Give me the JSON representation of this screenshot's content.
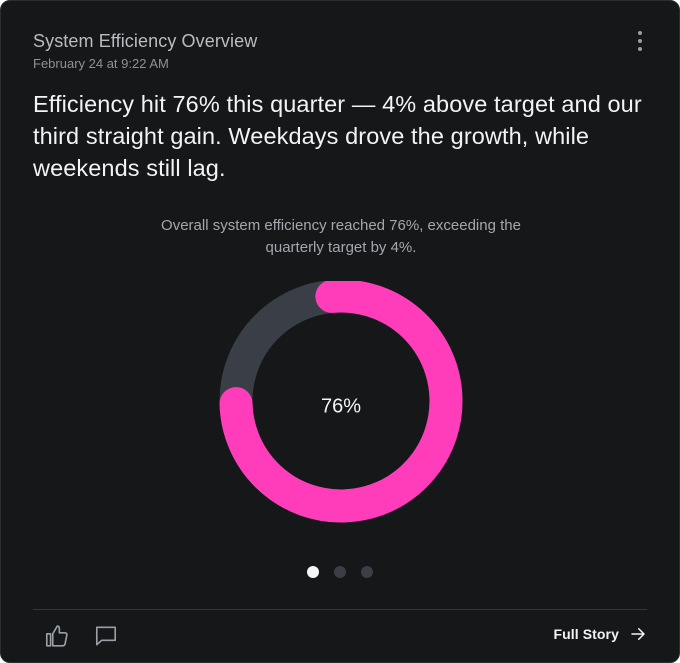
{
  "card": {
    "title": "System Efficiency Overview",
    "timestamp": "February 24 at 9:22 AM",
    "headline": "Efficiency hit 76% this quarter — 4% above target and our third straight gain. Weekdays drove the growth, while weekends still lag.",
    "caption": "Overall system efficiency reached 76%, exceeding the quarterly target by 4%."
  },
  "chart_data": {
    "type": "pie",
    "variant": "donut",
    "center_label": "76%",
    "slices": [
      {
        "value": 76,
        "color": "#ff3dbb"
      },
      {
        "value": 24,
        "color": "#3a3f47"
      }
    ]
  },
  "pagination": {
    "count": 3,
    "active_index": 0
  },
  "footer": {
    "like_icon": "thumbs-up-icon",
    "comment_icon": "comment-icon",
    "full_story_label": "Full Story",
    "arrow_icon": "arrow-right-icon"
  },
  "colors": {
    "background": "#151719",
    "accent": "#ff3dbb",
    "track": "#3a3f47"
  }
}
